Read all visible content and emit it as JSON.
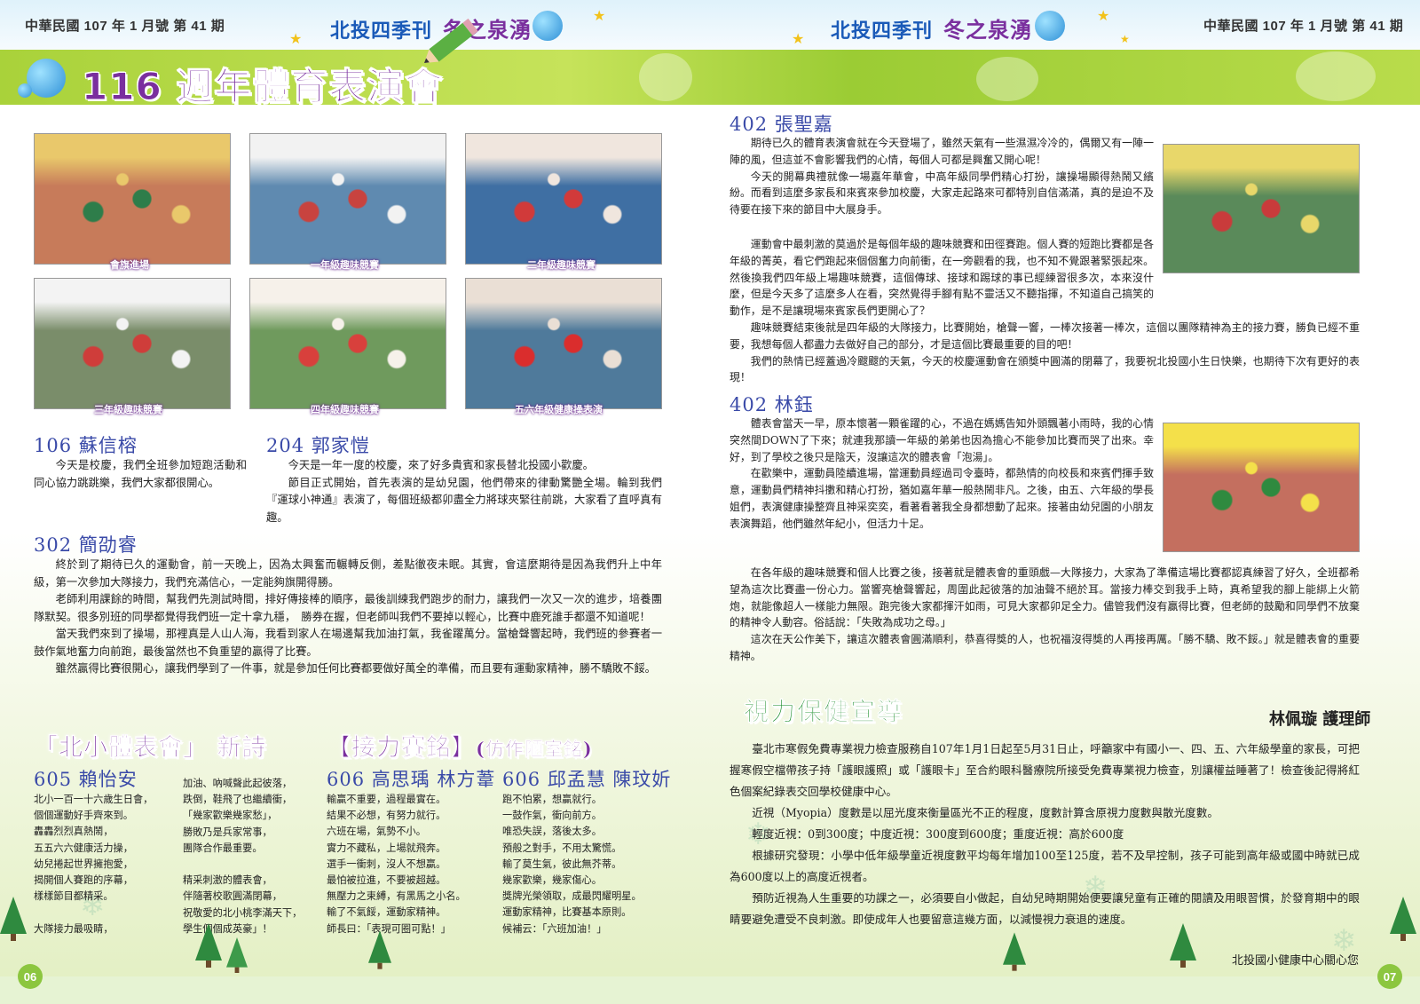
{
  "header": {
    "issue_left": "中華民國 107 年 1 月號 第 41 期",
    "issue_right": "中華民國 107 年 1 月號 第 41 期",
    "brand": "北投四季刊",
    "brand_sub": "冬之泉湧"
  },
  "main_title": "116 週年體育表演會",
  "photos": [
    {
      "caption": "會旗進場",
      "palette": [
        "#c77b5a",
        "#2e7d4a",
        "#e9c86b"
      ]
    },
    {
      "caption": "一年級趣味競賽",
      "palette": [
        "#5f8ab0",
        "#c8433f",
        "#f2f2f2"
      ]
    },
    {
      "caption": "二年級趣味競賽",
      "palette": [
        "#3f6fa3",
        "#d13a3a",
        "#f0e6de"
      ]
    },
    {
      "caption": "三年級趣味競賽",
      "palette": [
        "#7a8d6a",
        "#cf3d3a",
        "#f3f3f3"
      ]
    },
    {
      "caption": "四年級趣味競賽",
      "palette": [
        "#6f9a5d",
        "#d8403c",
        "#f6f1ea"
      ]
    },
    {
      "caption": "五六年級健康操表演",
      "palette": [
        "#4f7a9b",
        "#da2d2d",
        "#eadfd5"
      ]
    }
  ],
  "photos_right": [
    {
      "palette": [
        "#5a8a5a",
        "#c93b3b",
        "#e8d76a"
      ]
    },
    {
      "palette": [
        "#c46f5f",
        "#2f8a3f",
        "#f4e04a"
      ]
    }
  ],
  "articles": {
    "a106": {
      "title": "106 蘇信榕",
      "paragraphs": [
        "今天是校慶，我們全班參加短跑活動和同心協力跳跳樂，我們大家都很開心。"
      ]
    },
    "a204": {
      "title": "204 郭家愷",
      "paragraphs": [
        "今天是一年一度的校慶，來了好多貴賓和家長替北投國小歡慶。",
        "節目正式開始，首先表演的是幼兒園，他們帶來的律動驚艷全場。輪到我們『運球小神通』表演了，每個班級都卯盡全力將球夾緊往前跳，大家看了直呼真有趣。"
      ]
    },
    "a302": {
      "title": "302 簡劭睿",
      "paragraphs": [
        "終於到了期待已久的運動會，前一天晚上，因為太興奮而輾轉反側，差點徹夜未眠。其實，會這麼期待是因為我們升上中年級，第一次參加大隊接力，我們充滿信心，一定能夠旗開得勝。",
        "老師利用課餘的時間，幫我們先測試時間，排好傳接棒的順序，最後訓練我們跑步的耐力，讓我們一次又一次的進步，培養團隊默契。很多別班的同學都覺得我們班一定十拿九穩，　勝券在握，但老師叫我們不要掉以輕心，比賽中鹿死誰手都還不知道呢！",
        "當天我們來到了操場，那裡真是人山人海，我看到家人在場邊幫我加油打氣，我雀躍萬分。當槍聲響起時，我們班的參賽者一鼓作氣地奮力向前跑，最後當然也不負重望的贏得了比賽。",
        "雖然贏得比賽很開心，讓我們學到了一件事，就是參加任何比賽都要做好萬全的準備，而且要有運動家精神，勝不驕敗不餒。"
      ]
    },
    "a402a": {
      "title": "402 張聖嘉",
      "paragraphs": [
        "期待已久的體育表演會就在今天登場了，雖然天氣有一些濕濕冷冷的，偶爾又有一陣一陣的風，但這並不會影響我們的心情，每個人可都是興奮又開心呢！",
        "今天的開幕典禮就像一場嘉年華會，中高年級同學們精心打扮，讓操場顯得熱鬧又繽紛。而看到這麼多家長和來賓來參加校慶，大家走起路來可都特別自信滿滿，真的是迫不及待要在接下來的節目中大展身手。",
        "運動會中最刺激的莫過於是每個年級的趣味競賽和田徑賽跑。個人賽的短跑比賽都是各年級的菁英，看它們跑起來個個奮力向前衝，在一旁觀看的我，也不知不覺跟著緊張起來。然後換我們四年級上場趣味競賽，這個傳球、接球和踢球的事已經練習很多次，本來沒什麼，但是今天多了這麼多人在看，突然覺得手腳有點不靈活又不聽指揮，不知道自己搞笑的動作，是不是讓現場來賓家長們更開心了？",
        "趣味競賽結束後就是四年級的大隊接力，比賽開始，槍聲一響，一棒次接著一棒次，這個以團隊精神為主的接力賽，勝負已經不重要，我想每個人都盡力去做好自己的部分，才是這個比賽最重要的目的吧！",
        "我們的熱情已經蓋過冷颼颼的天氣，今天的校慶運動會在頒獎中圓滿的閉幕了，我要祝北投國小生日快樂，也期待下次有更好的表現！"
      ]
    },
    "a402b": {
      "title": "402 林鈺",
      "paragraphs": [
        "體表會當天一早，原本懷著一顆雀躍的心，不過在媽媽告知外頭飄著小雨時，我的心情突然間DOWN了下來；就連我那讀一年級的弟弟也因為擔心不能參加比賽而哭了出來。幸好，到了學校之後只是陰天，沒讓這次的體表會「泡湯」。",
        "在歡樂中，運動員陸續進場，當運動員經過司令臺時，都熱情的向校長和來賓們揮手致意，運動員們精神抖擻和精心打扮，猶如嘉年華一般熱鬧非凡。之後，由五、六年級的學長姐們，表演健康操整齊且神采奕奕，看著看著我全身都想動了起來。接著由幼兒園的小朋友表演舞蹈，他們雖然年紀小，但活力十足。",
        "在各年級的趣味競賽和個人比賽之後，接著就是體表會的重頭戲—大隊接力，大家為了準備這場比賽都認真練習了好久，全班都希望為這次比賽盡一份心力。當響亮槍聲響起，周圍此起彼落的加油聲不絕於耳。當接力棒交到我手上時，真希望我的腳上能綁上火箭炮，就能像超人一樣能力無限。跑完後大家都揮汗如雨，可見大家都卯足全力。儘管我們沒有贏得比賽，但老師的鼓勵和同學們不放棄的精神令人動容。俗話說：「失敗為成功之母。」",
        "這次在天公作美下，讓這次體表會圓滿順利，恭喜得獎的人，也祝福沒得獎的人再接再厲。「勝不驕、敗不餒。」就是體表會的重要精神。"
      ]
    }
  },
  "poems": {
    "heading1_a": "「北小體表會」",
    "heading1_b": "新詩",
    "heading2_a": "【接力賽銘】",
    "heading2_b": "(仿作陋室銘)",
    "p605": {
      "title": "605 賴怡安",
      "col1": [
        "北小一百一十六歲生日會，",
        "個個運動好手齊來到。",
        "轟轟烈烈真熱鬧，",
        "五五六六健康活力操，",
        "幼兒捲起世界擁抱愛，",
        "揭開個人賽跑的序幕，",
        "樣樣節目都精采。",
        "",
        "大隊接力最吸睛，"
      ],
      "col2": [
        "加油、吶喊聲此起彼落，",
        "跌倒，鞋飛了也繼續衝，",
        "「幾家歡樂幾家愁」，",
        "勝敗乃是兵家常事，",
        "團隊合作最重要。",
        "",
        "精采刺激的體表會，",
        "伴隨著校歌圓滿閉幕，",
        "祝敬愛的北小桃李滿天下，",
        "學生個個成英豪」！"
      ]
    },
    "p606a": {
      "title": "606 高思瑀 林方葦",
      "lines": [
        "輸贏不重要，過程最實在。",
        "結果不必想，有努力就行。",
        "六班在場，氣勢不小。",
        "實力不藏私，上場就飛奔。",
        "選手一衝刺，沒人不想贏。",
        "最怕被拉進，不要被超越。",
        "無壓力之束縛，有黑馬之小名。",
        "輸了不氣餒，運動家精神。",
        "師長曰：「表現可圈可點！」"
      ]
    },
    "p606b": {
      "title": "606 邱孟慧 陳玟妡",
      "lines": [
        "跑不怕累，想贏就行。",
        "一鼓作氣，衝向前方。",
        "唯恐失誤，落後太多。",
        "預般之對手，不用太驚慌。",
        "輸了莫生氣，彼此無芥蒂。",
        "幾家歡樂，幾家傷心。",
        "獎牌光榮領取，成最閃耀明星。",
        "運動家精神，比賽基本原則。",
        "候補云：「六班加油！」"
      ]
    }
  },
  "vision": {
    "heading": "視力保健宣導",
    "author": "林佩璇 護理師",
    "paragraphs": [
      "臺北市寒假免費專業視力檢查服務自107年1月1日起至5月31日止，呼籲家中有國小一、四、五、六年級學童的家長，可把握寒假空檔帶孩子持「護眼護照」或「護眼卡」至合約眼科醫療院所接受免費專業視力檢查，別讓權益睡著了！檢查後記得將紅色個案紀錄表交回學校健康中心。",
      "近視（Myopia）度數是以屈光度來衡量區光不正的程度，度數計算含原視力度數與散光度數。",
      "輕度近視：0到300度；中度近視：300度到600度；重度近視：高於600度",
      "根據研究發現：小學中低年級學童近視度數平均每年增加100至125度，若不及早控制，孩子可能到高年級或國中時就已成為600度以上的高度近視者。",
      "預防近視為人生重要的功課之一，必須要自小做起，自幼兒時期開始便要讓兒童有正確的閱讀及用眼習慣，於發育期中的眼睛要避免遭受不良刺激。即使成年人也要留意這幾方面，以減慢視力衰退的速度。"
    ],
    "footer": "北投國小健康中心關心您"
  },
  "page_numbers": {
    "left": "06",
    "right": "07"
  },
  "colors": {
    "title_purple": "#7a2f9e",
    "heading_blue": "#3a4aa8",
    "vision_green": "#1f8f2e",
    "band_green": "#a9d23a",
    "brand_blue": "#1a5ab8"
  }
}
